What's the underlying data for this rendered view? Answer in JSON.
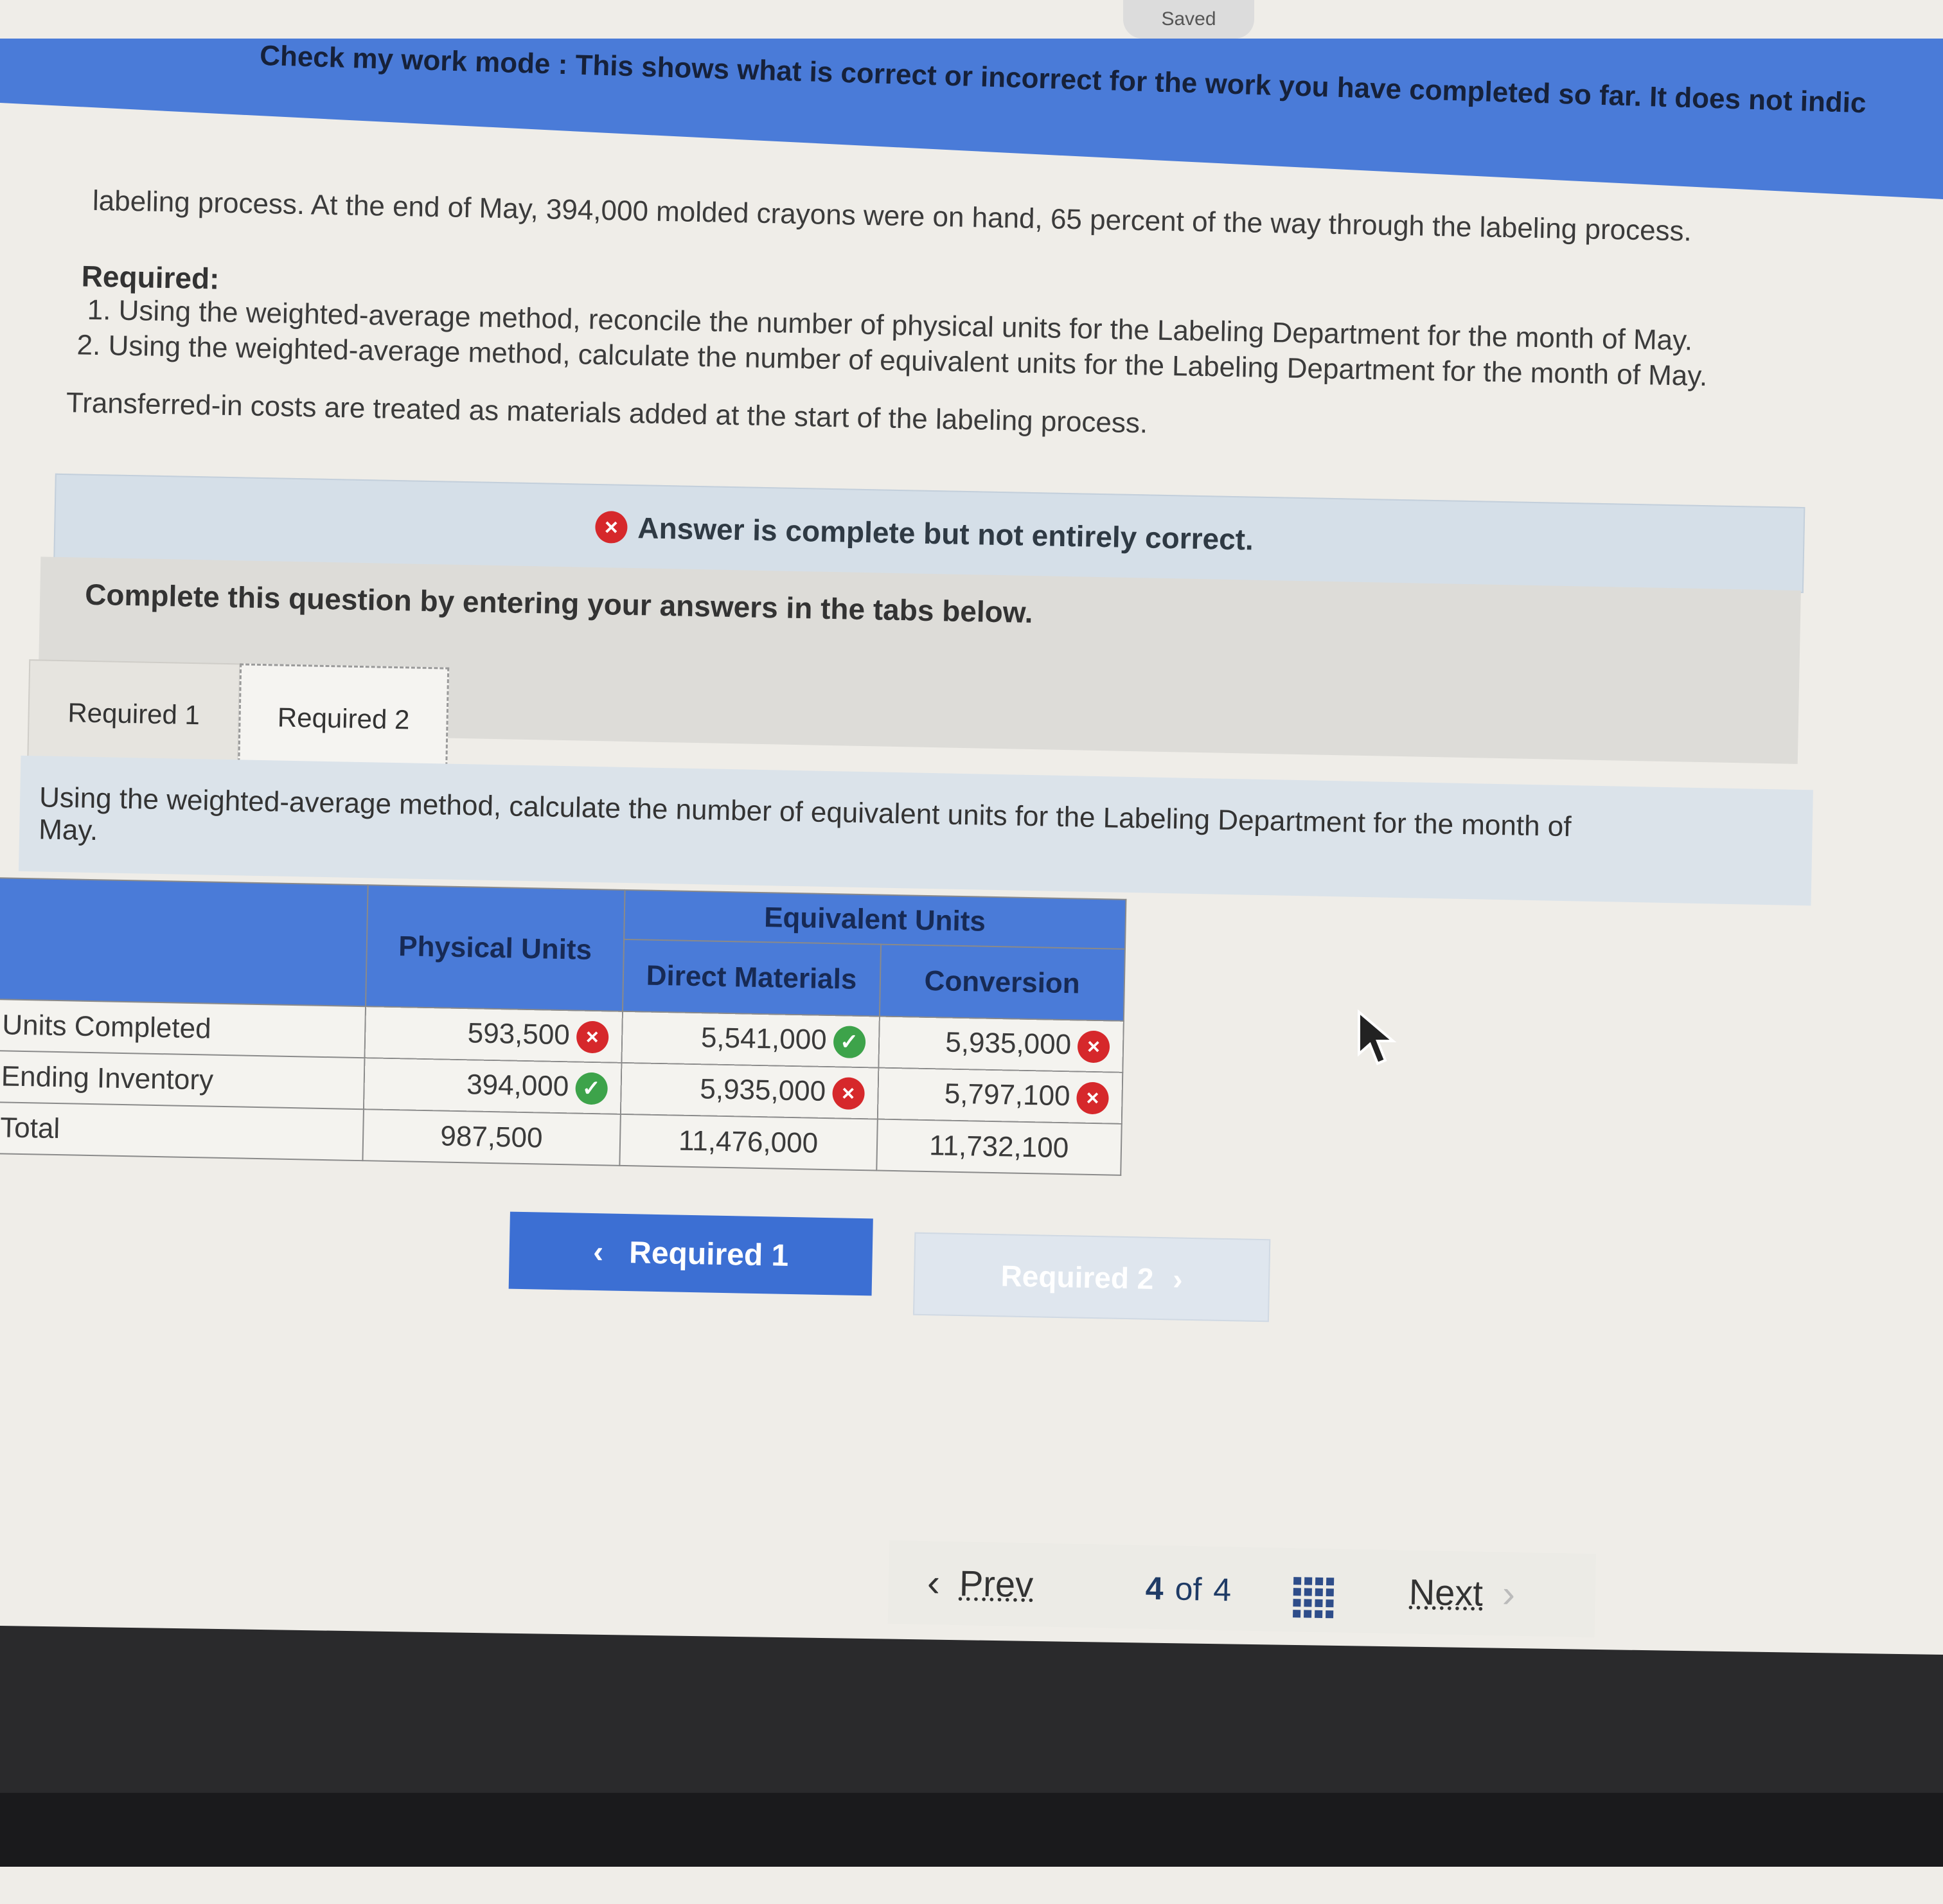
{
  "status": {
    "saved": "Saved"
  },
  "banner": {
    "text": "Check my work mode : This shows what is correct or incorrect for the work you have completed so far. It does not indic"
  },
  "problem": {
    "intro": "labeling process. At the end of May, 394,000 molded crayons were on hand, 65 percent of the way through the labeling process.",
    "required_title": "Required:",
    "req1": "1. Using the weighted-average method, reconcile the number of physical units for the Labeling Department for the month of May.",
    "req2": "2. Using the weighted-average method, calculate the number of equivalent units for the Labeling Department for the month of May.",
    "note": "Transferred-in costs are treated as materials added at the start of the labeling process."
  },
  "alert": {
    "text": "Answer is complete but not entirely correct."
  },
  "complete": {
    "text": "Complete this question by entering your answers in the tabs below."
  },
  "tabs": [
    {
      "label": "Required 1"
    },
    {
      "label": "Required 2"
    }
  ],
  "instructions": {
    "line1": "Using the weighted-average method, calculate the number of equivalent units for the Labeling Department for the month of",
    "line2": "May."
  },
  "table": {
    "headers": {
      "physical": "Physical Units",
      "equivalent": "Equivalent Units",
      "direct": "Direct Materials",
      "conversion": "Conversion"
    },
    "rows": [
      {
        "label": "Units Completed",
        "physical": "593,500",
        "physical_status": "incorrect",
        "direct": "5,541,000",
        "direct_status": "correct",
        "conversion": "5,935,000",
        "conversion_status": "incorrect"
      },
      {
        "label": "Ending Inventory",
        "physical": "394,000",
        "physical_status": "correct",
        "direct": "5,935,000",
        "direct_status": "incorrect",
        "conversion": "5,797,100",
        "conversion_status": "incorrect"
      },
      {
        "label": "Total",
        "physical": "987,500",
        "direct": "11,476,000",
        "conversion": "11,732,100"
      }
    ]
  },
  "buttons": {
    "prev_required": "Required 1",
    "next_required": "Required 2"
  },
  "pager": {
    "prev": "Prev",
    "current": "4",
    "of": "of",
    "total": "4",
    "next": "Next"
  },
  "colors": {
    "banner": "#4a7bd8",
    "correct": "#3da34a",
    "incorrect": "#d6282b"
  }
}
